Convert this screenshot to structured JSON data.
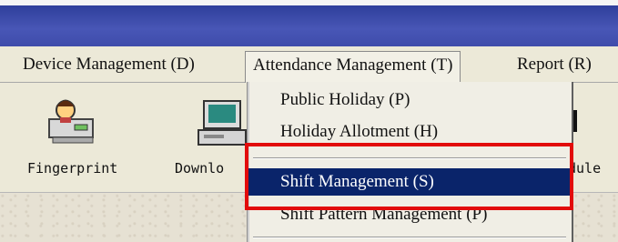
{
  "menubar": {
    "items": [
      {
        "label": "Device Management (D)"
      },
      {
        "label": "Attendance Management (T)"
      },
      {
        "label": "Report (R)"
      }
    ]
  },
  "toolbar": {
    "buttons": [
      {
        "label": "Fingerprint",
        "icon": "fingerprint-device-icon"
      },
      {
        "label": "Downlo",
        "icon": "download-computer-icon"
      },
      {
        "label": "dule",
        "icon": "schedule-icon"
      }
    ]
  },
  "dropdown": {
    "items": [
      {
        "label": "Public Holiday (P)"
      },
      {
        "label": "Holiday Allotment (H)"
      },
      {
        "label": "Shift Management (S)",
        "selected": true
      },
      {
        "label": "Shift Pattern Management (P)"
      }
    ]
  },
  "colors": {
    "title_bar": "#3f4cab",
    "selection": "#0a246a",
    "highlight_box": "#e20b0b"
  }
}
